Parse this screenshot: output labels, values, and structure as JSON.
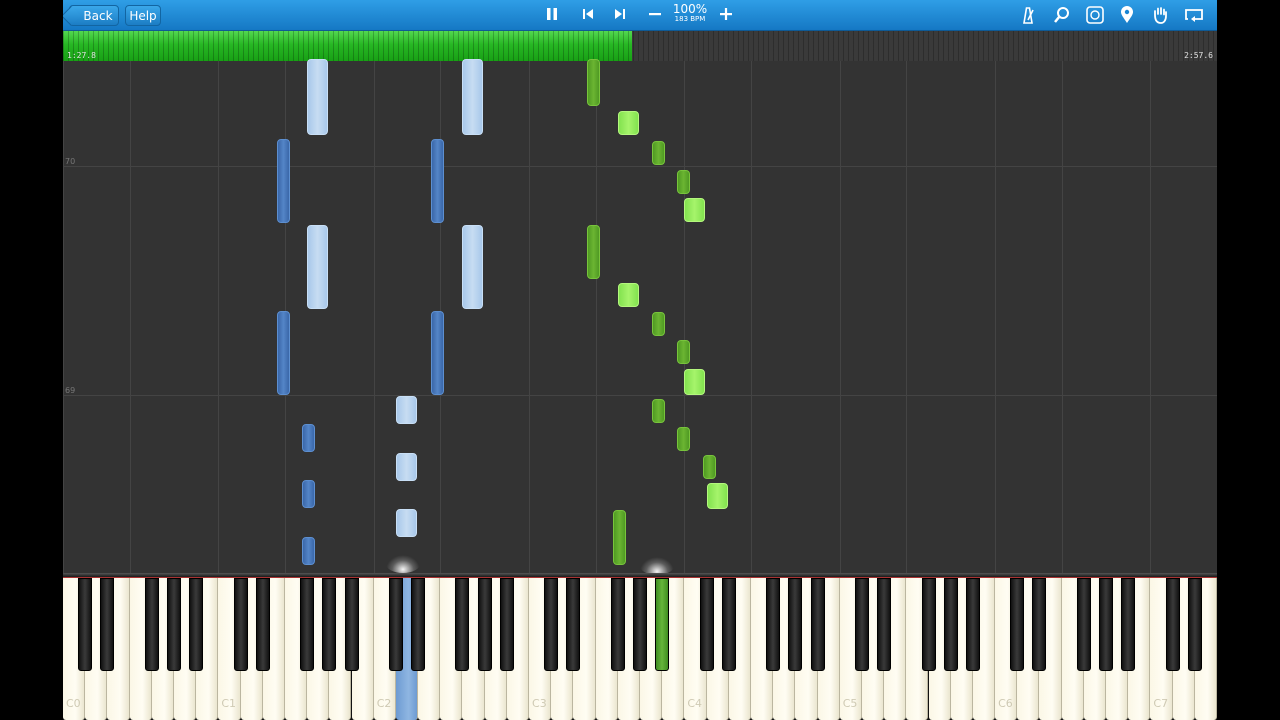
{
  "toolbar": {
    "back_label": "Back",
    "help_label": "Help",
    "speed_percent": "100%",
    "tempo_label": "183 BPM",
    "icons": [
      "pause-icon",
      "skip-back-icon",
      "skip-forward-icon",
      "minus-icon",
      "plus-icon",
      "metronome-icon",
      "magnifier-icon",
      "notation-icon",
      "marker-icon",
      "hand-icon",
      "loop-icon"
    ],
    "accent": "#1a86d4"
  },
  "progress": {
    "current_time": "1:27.8",
    "total_time": "2:57.6",
    "fraction": 0.493,
    "fill_color": "#27b724"
  },
  "measures": [
    {
      "label": "70"
    },
    {
      "label": "69"
    }
  ],
  "keyboard": {
    "octave_labels": [
      "C0",
      "C1",
      "C2",
      "C3",
      "C4",
      "C5",
      "C6",
      "C7"
    ],
    "active_white_color": "#8fb6e2",
    "active_black_color": "#66b53b"
  },
  "notes": {
    "left_hand_color": "#5485c7",
    "right_hand_color": "#7fd94a"
  }
}
